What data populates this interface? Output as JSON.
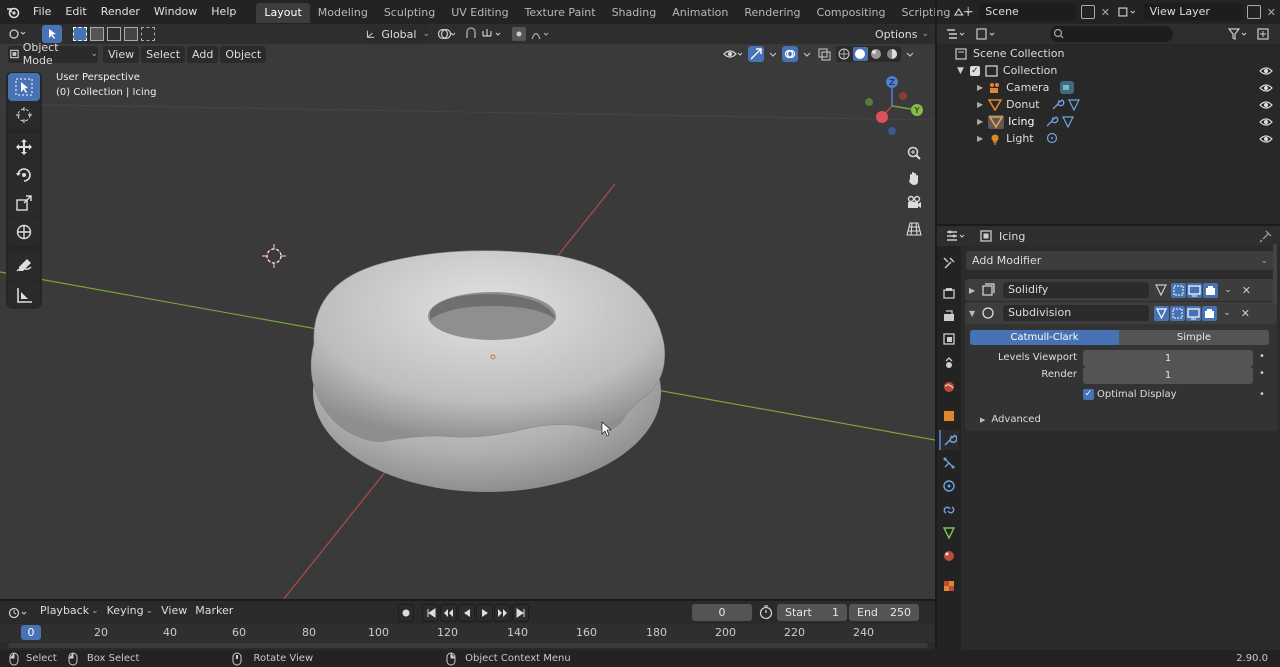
{
  "topbar": {
    "menus": [
      "File",
      "Edit",
      "Render",
      "Window",
      "Help"
    ],
    "workspaces": [
      "Layout",
      "Modeling",
      "Sculpting",
      "UV Editing",
      "Texture Paint",
      "Shading",
      "Animation",
      "Rendering",
      "Compositing",
      "Scripting"
    ],
    "active_workspace": "Layout",
    "scene": "Scene",
    "view_layer": "View Layer"
  },
  "toolheader": {
    "orientation": "Global",
    "options": "Options"
  },
  "viewport_header": {
    "mode": "Object Mode",
    "menus": [
      "View",
      "Select",
      "Add",
      "Object"
    ]
  },
  "viewport": {
    "perspective": "User Perspective",
    "collection_label": "(0) Collection | Icing"
  },
  "outliner": {
    "scene_collection": "Scene Collection",
    "collection": "Collection",
    "objects": [
      "Camera",
      "Donut",
      "Icing",
      "Light"
    ]
  },
  "properties": {
    "object_name": "Icing",
    "add_modifier": "Add Modifier",
    "modifiers": [
      "Solidify",
      "Subdivision"
    ],
    "subdiv_tabs": [
      "Catmull-Clark",
      "Simple"
    ],
    "levels_viewport_label": "Levels Viewport",
    "levels_viewport_value": "1",
    "render_label": "Render",
    "render_value": "1",
    "optimal_display": "Optimal Display",
    "advanced": "Advanced"
  },
  "timeline": {
    "menus": [
      "Playback",
      "Keying",
      "View",
      "Marker"
    ],
    "current_frame": "0",
    "start_label": "Start",
    "start_value": "1",
    "end_label": "End",
    "end_value": "250",
    "ruler": [
      "0",
      "20",
      "40",
      "60",
      "80",
      "100",
      "120",
      "140",
      "160",
      "180",
      "200",
      "220",
      "240"
    ]
  },
  "statusbar": {
    "select": "Select",
    "box_select": "Box Select",
    "rotate_view": "Rotate View",
    "context_menu": "Object Context Menu",
    "version": "2.90.0"
  },
  "colors": {
    "accent": "#4772b3",
    "x_axis": "#b34a4a",
    "y_axis": "#7aa23c",
    "z_axis": "#4d7fd4"
  }
}
